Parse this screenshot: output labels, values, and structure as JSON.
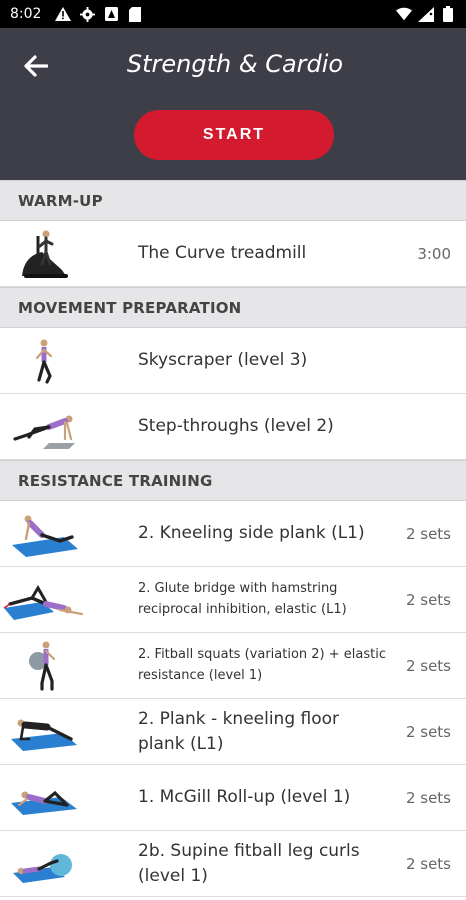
{
  "status_bar": {
    "time": "8:02"
  },
  "header": {
    "title": "Strength & Cardio",
    "start_label": "START"
  },
  "sections": [
    {
      "title": "WARM-UP",
      "items": [
        {
          "label": "The Curve treadmill",
          "meta": "3:00"
        }
      ]
    },
    {
      "title": "MOVEMENT PREPARATION",
      "items": [
        {
          "label": "Skyscraper (level 3)",
          "meta": ""
        },
        {
          "label": "Step-throughs (level 2)",
          "meta": ""
        }
      ]
    },
    {
      "title": "RESISTANCE TRAINING",
      "items": [
        {
          "label": "2. Kneeling side plank (L1)",
          "meta": "2 sets"
        },
        {
          "label": "2. Glute bridge with hamstring reciprocal inhibition, elastic (L1)",
          "meta": "2 sets"
        },
        {
          "label": "2. Fitball squats (variation 2) + elastic resistance (level 1)",
          "meta": "2 sets"
        },
        {
          "label": "2. Plank - kneeling floor plank (L1)",
          "meta": "2 sets"
        },
        {
          "label": "1. McGill Roll-up (level 1)",
          "meta": "2 sets"
        },
        {
          "label": "2b. Supine fitball leg curls (level 1)",
          "meta": "2 sets"
        }
      ]
    }
  ],
  "colors": {
    "header_bg": "#3e3e48",
    "start_button": "#d31a2e",
    "section_bg": "#e6e6e9",
    "mat_blue": "#2a7fd0",
    "shirt_purple": "#9b6fc9"
  }
}
